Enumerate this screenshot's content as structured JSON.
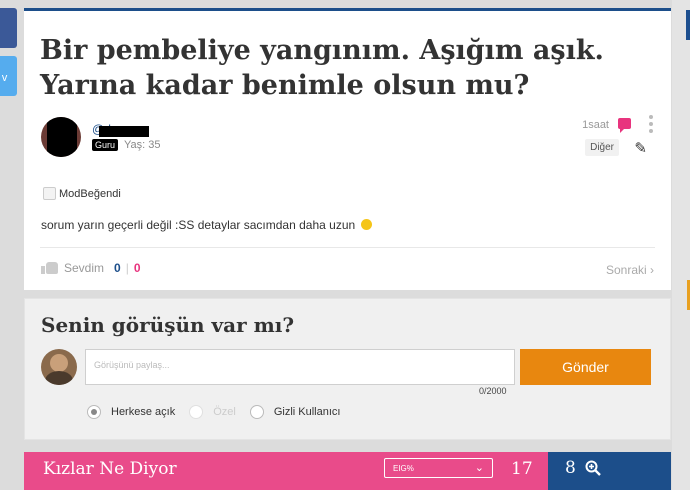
{
  "question": {
    "title": "Bir pembeliye yangınım. Aşığım aşık. Yarına kadar benimle olsun mu?",
    "user_at": "@",
    "user_name_partial": "b",
    "badge": "Guru",
    "age": "Yaş: 35",
    "time": "1saat",
    "other_label": "Diğer",
    "mod_label": "ModBeğendi",
    "body": "sorum yarın geçerli değil :SS detaylar sacımdan daha uzun",
    "like_label": "Sevdim",
    "like_count_boys": "0",
    "like_separator": "|",
    "like_count_girls": "0",
    "next_label": "Sonraki",
    "next_chevron": "›"
  },
  "comment": {
    "title": "Senin görüşün var mı?",
    "placeholder": "Görüşünü paylaş...",
    "counter": "0/2000",
    "send_label": "Gönder",
    "privacy_options": [
      {
        "label": "Herkese açık",
        "selected": true,
        "enabled": true
      },
      {
        "label": "Özel",
        "selected": false,
        "enabled": false
      },
      {
        "label": "Gizli Kullanıcı",
        "selected": false,
        "enabled": true
      }
    ]
  },
  "answers_bar": {
    "title": "Kızlar Ne Diyor",
    "select_value": "EIG%",
    "select_chevron": "⌄",
    "girls_count": "17",
    "boys_count": "8"
  },
  "colors": {
    "brand_blue": "#1c4e8a",
    "brand_pink": "#e94b8a",
    "send_orange": "#e8870f"
  },
  "icons": {
    "share_twitter": "twitter-icon",
    "share_facebook": "facebook-icon",
    "chat": "chat-bubble-icon",
    "edit": "pencil-icon",
    "like": "thumbs-up-icon",
    "zoom": "zoom-in-icon"
  }
}
